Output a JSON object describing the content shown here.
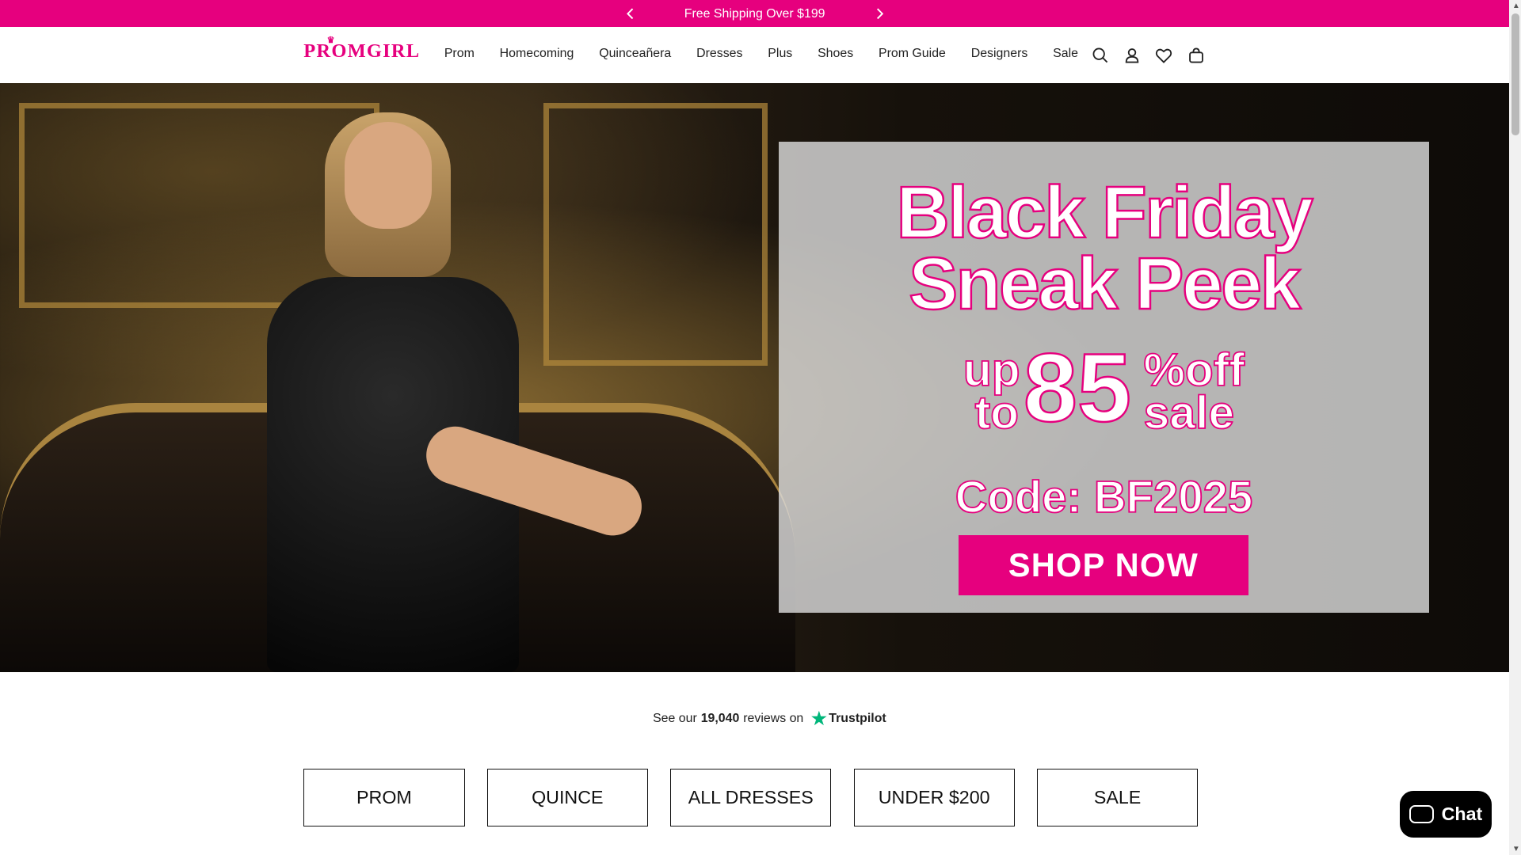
{
  "announcement": {
    "text": "Free Shipping Over $199",
    "prev_icon": "chevron-left-icon",
    "next_icon": "chevron-right-icon",
    "background": "#e6007e"
  },
  "header": {
    "logo": "PROMGIRL",
    "nav": [
      "Prom",
      "Homecoming",
      "Quinceañera",
      "Dresses",
      "Plus",
      "Shoes",
      "Prom Guide",
      "Designers",
      "Sale"
    ],
    "icons": [
      "search-icon",
      "account-icon",
      "wishlist-icon",
      "cart-icon"
    ]
  },
  "hero": {
    "headline_line1": "Black Friday",
    "headline_line2": "Sneak Peek",
    "up_to": "up to",
    "percent": "85",
    "percent_suffix": "% off sale",
    "code": "Code: BF2025",
    "cta": "SHOP NOW"
  },
  "trustpilot": {
    "prefix": "See our",
    "count": "19,040",
    "suffix": "reviews on",
    "brand": "Trustpilot"
  },
  "categories": [
    "PROM",
    "QUINCE",
    "ALL DRESSES",
    "UNDER $200",
    "SALE"
  ],
  "chat": {
    "label": "Chat"
  },
  "colors": {
    "brand": "#e6007e",
    "text": "#111111"
  }
}
